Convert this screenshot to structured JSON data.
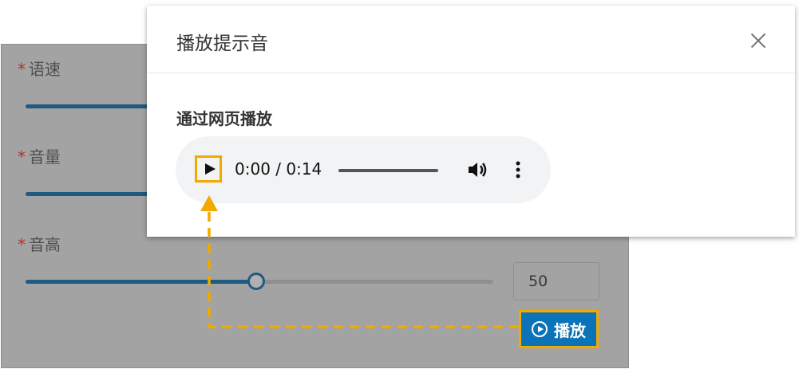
{
  "settings": {
    "fields": [
      {
        "label": "语速",
        "required_mark": "*"
      },
      {
        "label": "音量",
        "required_mark": "*"
      },
      {
        "label": "音高",
        "required_mark": "*",
        "value": "50",
        "slider_level": 0.5
      }
    ],
    "play_button_label": "播放"
  },
  "dialog": {
    "title": "播放提示音",
    "section_label": "通过网页播放",
    "player": {
      "time": "0:00 / 0:14"
    }
  },
  "colors": {
    "accent": "#0b73b8",
    "highlight": "#f2a900",
    "slider": "#1f5a80"
  }
}
